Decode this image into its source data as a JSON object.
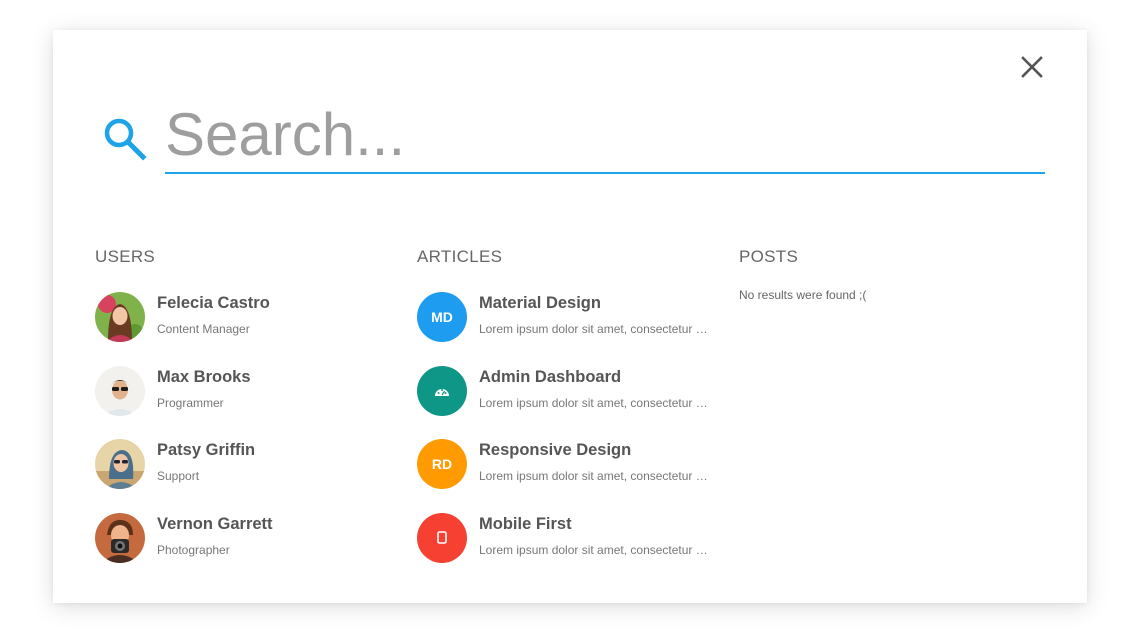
{
  "search": {
    "placeholder": "Search...",
    "value": ""
  },
  "colors": {
    "accent": "#1ca3e8",
    "close": "#555555"
  },
  "icons": {
    "search": "search-icon",
    "close": "close-icon"
  },
  "users": {
    "title": "USERS",
    "items": [
      {
        "name": "Felecia Castro",
        "role": "Content Manager"
      },
      {
        "name": "Max Brooks",
        "role": "Programmer"
      },
      {
        "name": "Patsy Griffin",
        "role": "Support"
      },
      {
        "name": "Vernon Garrett",
        "role": "Photographer"
      }
    ]
  },
  "articles": {
    "title": "ARTICLES",
    "items": [
      {
        "badge": "MD",
        "color": "#1e9cf0",
        "title": "Material Design",
        "excerpt": "Lorem ipsum dolor sit amet, consectetur adipiscing elit"
      },
      {
        "badge": "",
        "icon": "dashboard-icon",
        "color": "#0e9686",
        "title": "Admin Dashboard",
        "excerpt": "Lorem ipsum dolor sit amet, consectetur adipiscing elit"
      },
      {
        "badge": "RD",
        "color": "#ff9b00",
        "title": "Responsive Design",
        "excerpt": "Lorem ipsum dolor sit amet, consectetur adipiscing elit"
      },
      {
        "badge": "",
        "icon": "mobile-icon",
        "color": "#f64132",
        "title": "Mobile First",
        "excerpt": "Lorem ipsum dolor sit amet, consectetur adipiscing elit"
      }
    ]
  },
  "posts": {
    "title": "POSTS",
    "empty_message": "No results were found ;("
  }
}
